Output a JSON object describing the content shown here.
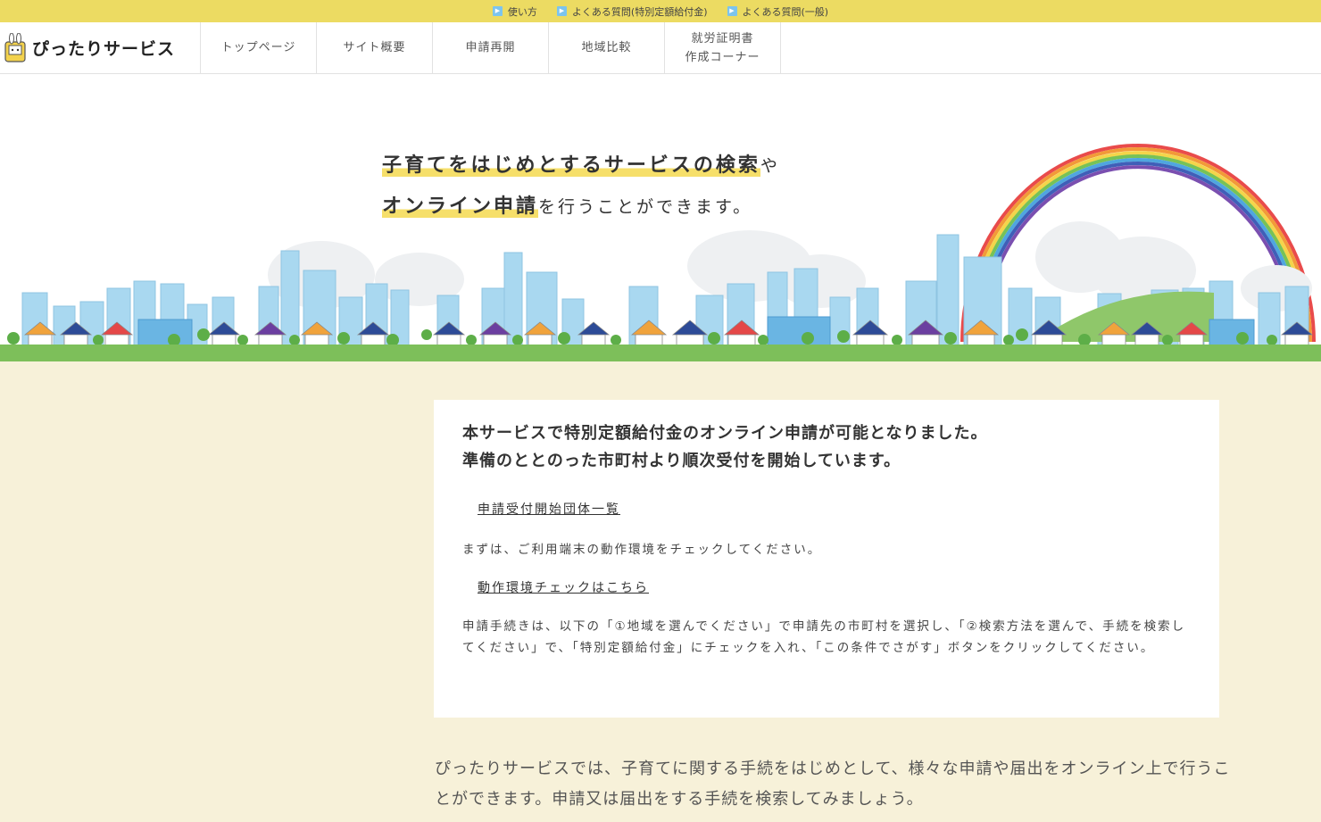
{
  "util_links": [
    {
      "label": "使い方",
      "icon": "play-icon"
    },
    {
      "label": "よくある質問(特別定額給付金)",
      "icon": "play-icon"
    },
    {
      "label": "よくある質問(一般)",
      "icon": "play-icon"
    }
  ],
  "header": {
    "logo_text": "ぴったりサービス",
    "nav": [
      {
        "label": "トップページ"
      },
      {
        "label": "サイト概要"
      },
      {
        "label": "申請再開"
      },
      {
        "label": "地域比較"
      },
      {
        "label_line1": "就労証明書",
        "label_line2": "作成コーナー"
      }
    ]
  },
  "hero": {
    "line1_highlight": "子育てをはじめとするサービスの検索",
    "line1_tail": "や",
    "line2_highlight": "オンライン申請",
    "line2_tail": "を行うことができます。"
  },
  "notice": {
    "title_line1": "本サービスで特別定額給付金のオンライン申請が可能となりました。",
    "title_line2": "準備のととのった市町村より順次受付を開始しています。",
    "link1": "申請受付開始団体一覧",
    "text1": "まずは、ご利用端末の動作環境をチェックしてください。",
    "link2": "動作環境チェックはこちら",
    "text2": "申請手続きは、以下の「①地域を選んでください」で申請先の市町村を選択し、「②検索方法を選んで、手続を検索してください」で、「特別定額給付金」にチェックを入れ、「この条件でさがす」ボタンをクリックしてください。"
  },
  "intro": {
    "text": "ぴったりサービスでは、子育てに関する手続をはじめとして、様々な申請や届出をオンライン上で行うことができます。申請又は届出をする手続を検索してみましょう。"
  },
  "colors": {
    "util_bar": "#ecdb62",
    "page_bg": "#f7f1d9",
    "highlight": "#f6df6a",
    "grass": "#7dbf5a",
    "building": "#8ccdec"
  }
}
